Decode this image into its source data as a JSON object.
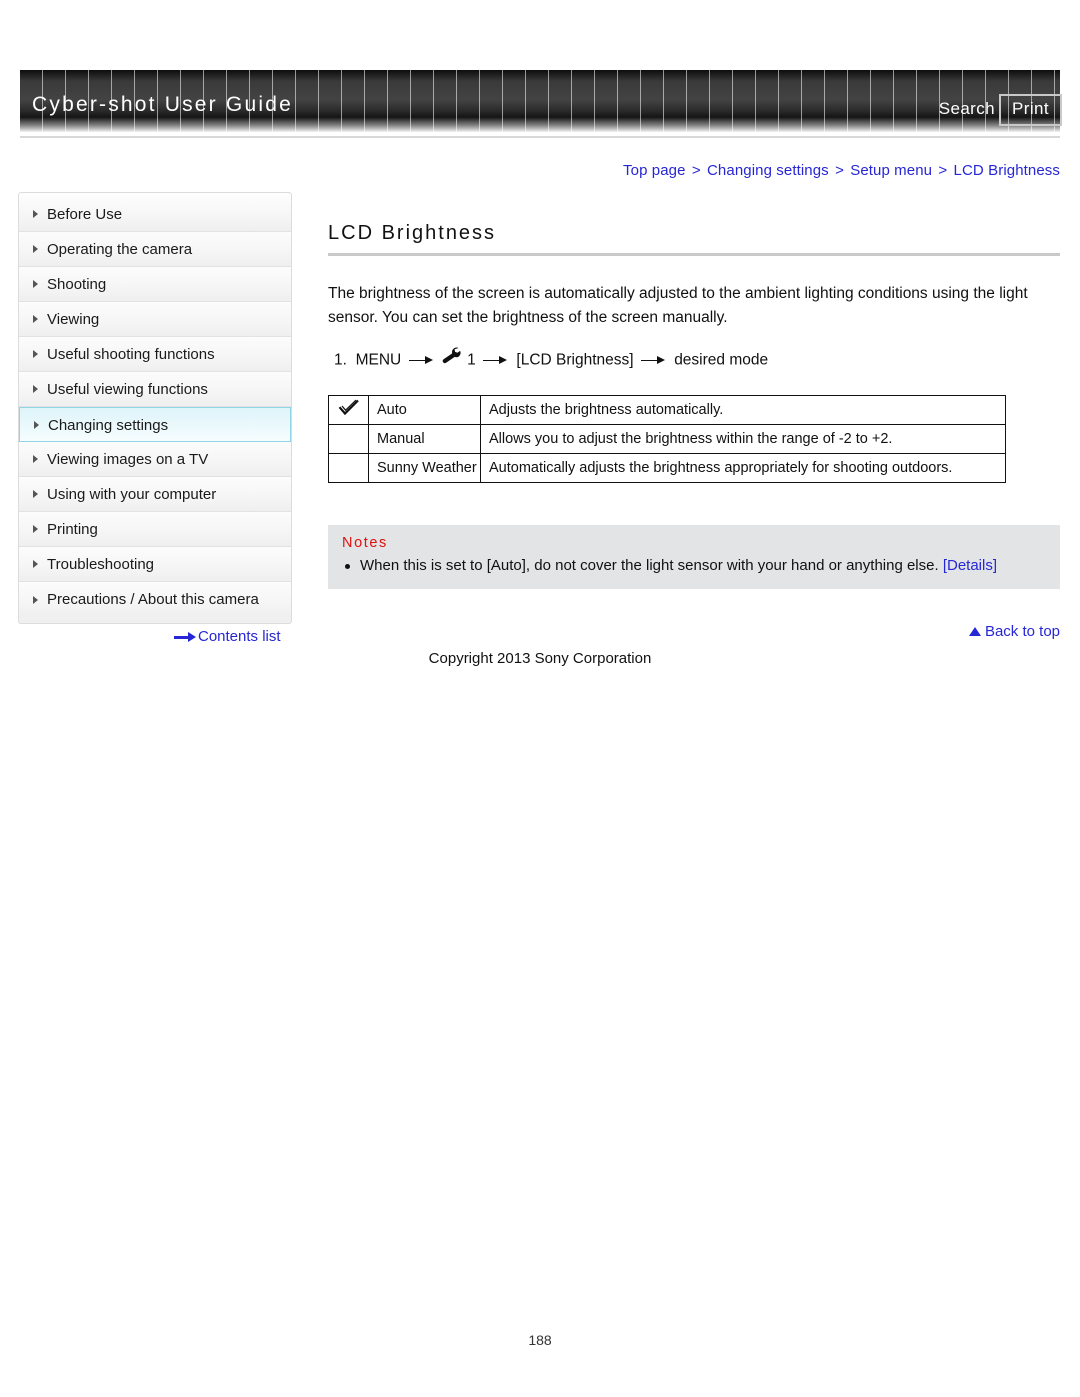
{
  "header": {
    "site_title": "Cyber-shot User Guide",
    "search_label": "Search",
    "print_label": "Print"
  },
  "breadcrumb": {
    "items": [
      "Top page",
      "Changing settings",
      "Setup menu",
      "LCD Brightness"
    ],
    "separator": ">"
  },
  "sidebar": {
    "items": [
      {
        "label": "Before Use",
        "active": false
      },
      {
        "label": "Operating the camera",
        "active": false
      },
      {
        "label": "Shooting",
        "active": false
      },
      {
        "label": "Viewing",
        "active": false
      },
      {
        "label": "Useful shooting functions",
        "active": false
      },
      {
        "label": "Useful viewing functions",
        "active": false
      },
      {
        "label": "Changing settings",
        "active": true
      },
      {
        "label": "Viewing images on a TV",
        "active": false
      },
      {
        "label": "Using with your computer",
        "active": false
      },
      {
        "label": "Printing",
        "active": false
      },
      {
        "label": "Troubleshooting",
        "active": false
      },
      {
        "label": "Precautions / About this camera",
        "active": false
      }
    ],
    "contents_list_label": "Contents list"
  },
  "main": {
    "title": "LCD Brightness",
    "intro": "The brightness of the screen is automatically adjusted to the ambient lighting conditions using the light sensor. You can set the brightness of the screen manually.",
    "step": {
      "number": "1.",
      "part1": "MENU",
      "part2": "1",
      "part3": "[LCD Brightness]",
      "part4": "desired mode"
    },
    "table": {
      "rows": [
        {
          "marked": true,
          "name": "Auto",
          "description": "Adjusts the brightness automatically."
        },
        {
          "marked": false,
          "name": "Manual",
          "description": "Allows you to adjust the brightness within the range of -2 to +2."
        },
        {
          "marked": false,
          "name": "Sunny Weather",
          "description": "Automatically adjusts the brightness appropriately for shooting outdoors."
        }
      ]
    },
    "notes": {
      "heading": "Notes",
      "items": [
        {
          "text": "When this is set to [Auto], do not cover the light sensor with your hand or anything else.",
          "link_label": "[Details]"
        }
      ]
    },
    "back_to_top_label": "Back to top"
  },
  "footer": {
    "copyright": "Copyright 2013 Sony Corporation",
    "page_number": "188"
  },
  "colors": {
    "link": "#2626d6",
    "notes_heading": "#e01010",
    "notes_background": "#e2e4e6",
    "sidebar_active": "#ddf4fa",
    "sidebar_active_border": "#8fd5e6"
  }
}
